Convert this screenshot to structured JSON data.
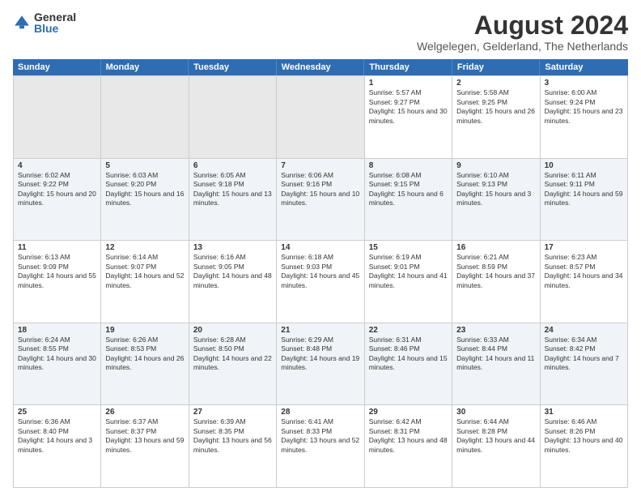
{
  "header": {
    "logo_general": "General",
    "logo_blue": "Blue",
    "month_title": "August 2024",
    "location": "Welgelegen, Gelderland, The Netherlands"
  },
  "calendar": {
    "days_of_week": [
      "Sunday",
      "Monday",
      "Tuesday",
      "Wednesday",
      "Thursday",
      "Friday",
      "Saturday"
    ],
    "weeks": [
      [
        {
          "day": "",
          "sunrise": "",
          "sunset": "",
          "daylight": "",
          "empty": true
        },
        {
          "day": "",
          "sunrise": "",
          "sunset": "",
          "daylight": "",
          "empty": true
        },
        {
          "day": "",
          "sunrise": "",
          "sunset": "",
          "daylight": "",
          "empty": true
        },
        {
          "day": "",
          "sunrise": "",
          "sunset": "",
          "daylight": "",
          "empty": true
        },
        {
          "day": "1",
          "sunrise": "Sunrise: 5:57 AM",
          "sunset": "Sunset: 9:27 PM",
          "daylight": "Daylight: 15 hours and 30 minutes.",
          "empty": false
        },
        {
          "day": "2",
          "sunrise": "Sunrise: 5:58 AM",
          "sunset": "Sunset: 9:25 PM",
          "daylight": "Daylight: 15 hours and 26 minutes.",
          "empty": false
        },
        {
          "day": "3",
          "sunrise": "Sunrise: 6:00 AM",
          "sunset": "Sunset: 9:24 PM",
          "daylight": "Daylight: 15 hours and 23 minutes.",
          "empty": false
        }
      ],
      [
        {
          "day": "4",
          "sunrise": "Sunrise: 6:02 AM",
          "sunset": "Sunset: 9:22 PM",
          "daylight": "Daylight: 15 hours and 20 minutes.",
          "empty": false
        },
        {
          "day": "5",
          "sunrise": "Sunrise: 6:03 AM",
          "sunset": "Sunset: 9:20 PM",
          "daylight": "Daylight: 15 hours and 16 minutes.",
          "empty": false
        },
        {
          "day": "6",
          "sunrise": "Sunrise: 6:05 AM",
          "sunset": "Sunset: 9:18 PM",
          "daylight": "Daylight: 15 hours and 13 minutes.",
          "empty": false
        },
        {
          "day": "7",
          "sunrise": "Sunrise: 6:06 AM",
          "sunset": "Sunset: 9:16 PM",
          "daylight": "Daylight: 15 hours and 10 minutes.",
          "empty": false
        },
        {
          "day": "8",
          "sunrise": "Sunrise: 6:08 AM",
          "sunset": "Sunset: 9:15 PM",
          "daylight": "Daylight: 15 hours and 6 minutes.",
          "empty": false
        },
        {
          "day": "9",
          "sunrise": "Sunrise: 6:10 AM",
          "sunset": "Sunset: 9:13 PM",
          "daylight": "Daylight: 15 hours and 3 minutes.",
          "empty": false
        },
        {
          "day": "10",
          "sunrise": "Sunrise: 6:11 AM",
          "sunset": "Sunset: 9:11 PM",
          "daylight": "Daylight: 14 hours and 59 minutes.",
          "empty": false
        }
      ],
      [
        {
          "day": "11",
          "sunrise": "Sunrise: 6:13 AM",
          "sunset": "Sunset: 9:09 PM",
          "daylight": "Daylight: 14 hours and 55 minutes.",
          "empty": false
        },
        {
          "day": "12",
          "sunrise": "Sunrise: 6:14 AM",
          "sunset": "Sunset: 9:07 PM",
          "daylight": "Daylight: 14 hours and 52 minutes.",
          "empty": false
        },
        {
          "day": "13",
          "sunrise": "Sunrise: 6:16 AM",
          "sunset": "Sunset: 9:05 PM",
          "daylight": "Daylight: 14 hours and 48 minutes.",
          "empty": false
        },
        {
          "day": "14",
          "sunrise": "Sunrise: 6:18 AM",
          "sunset": "Sunset: 9:03 PM",
          "daylight": "Daylight: 14 hours and 45 minutes.",
          "empty": false
        },
        {
          "day": "15",
          "sunrise": "Sunrise: 6:19 AM",
          "sunset": "Sunset: 9:01 PM",
          "daylight": "Daylight: 14 hours and 41 minutes.",
          "empty": false
        },
        {
          "day": "16",
          "sunrise": "Sunrise: 6:21 AM",
          "sunset": "Sunset: 8:59 PM",
          "daylight": "Daylight: 14 hours and 37 minutes.",
          "empty": false
        },
        {
          "day": "17",
          "sunrise": "Sunrise: 6:23 AM",
          "sunset": "Sunset: 8:57 PM",
          "daylight": "Daylight: 14 hours and 34 minutes.",
          "empty": false
        }
      ],
      [
        {
          "day": "18",
          "sunrise": "Sunrise: 6:24 AM",
          "sunset": "Sunset: 8:55 PM",
          "daylight": "Daylight: 14 hours and 30 minutes.",
          "empty": false
        },
        {
          "day": "19",
          "sunrise": "Sunrise: 6:26 AM",
          "sunset": "Sunset: 8:53 PM",
          "daylight": "Daylight: 14 hours and 26 minutes.",
          "empty": false
        },
        {
          "day": "20",
          "sunrise": "Sunrise: 6:28 AM",
          "sunset": "Sunset: 8:50 PM",
          "daylight": "Daylight: 14 hours and 22 minutes.",
          "empty": false
        },
        {
          "day": "21",
          "sunrise": "Sunrise: 6:29 AM",
          "sunset": "Sunset: 8:48 PM",
          "daylight": "Daylight: 14 hours and 19 minutes.",
          "empty": false
        },
        {
          "day": "22",
          "sunrise": "Sunrise: 6:31 AM",
          "sunset": "Sunset: 8:46 PM",
          "daylight": "Daylight: 14 hours and 15 minutes.",
          "empty": false
        },
        {
          "day": "23",
          "sunrise": "Sunrise: 6:33 AM",
          "sunset": "Sunset: 8:44 PM",
          "daylight": "Daylight: 14 hours and 11 minutes.",
          "empty": false
        },
        {
          "day": "24",
          "sunrise": "Sunrise: 6:34 AM",
          "sunset": "Sunset: 8:42 PM",
          "daylight": "Daylight: 14 hours and 7 minutes.",
          "empty": false
        }
      ],
      [
        {
          "day": "25",
          "sunrise": "Sunrise: 6:36 AM",
          "sunset": "Sunset: 8:40 PM",
          "daylight": "Daylight: 14 hours and 3 minutes.",
          "empty": false
        },
        {
          "day": "26",
          "sunrise": "Sunrise: 6:37 AM",
          "sunset": "Sunset: 8:37 PM",
          "daylight": "Daylight: 13 hours and 59 minutes.",
          "empty": false
        },
        {
          "day": "27",
          "sunrise": "Sunrise: 6:39 AM",
          "sunset": "Sunset: 8:35 PM",
          "daylight": "Daylight: 13 hours and 56 minutes.",
          "empty": false
        },
        {
          "day": "28",
          "sunrise": "Sunrise: 6:41 AM",
          "sunset": "Sunset: 8:33 PM",
          "daylight": "Daylight: 13 hours and 52 minutes.",
          "empty": false
        },
        {
          "day": "29",
          "sunrise": "Sunrise: 6:42 AM",
          "sunset": "Sunset: 8:31 PM",
          "daylight": "Daylight: 13 hours and 48 minutes.",
          "empty": false
        },
        {
          "day": "30",
          "sunrise": "Sunrise: 6:44 AM",
          "sunset": "Sunset: 8:28 PM",
          "daylight": "Daylight: 13 hours and 44 minutes.",
          "empty": false
        },
        {
          "day": "31",
          "sunrise": "Sunrise: 6:46 AM",
          "sunset": "Sunset: 8:26 PM",
          "daylight": "Daylight: 13 hours and 40 minutes.",
          "empty": false
        }
      ]
    ]
  }
}
